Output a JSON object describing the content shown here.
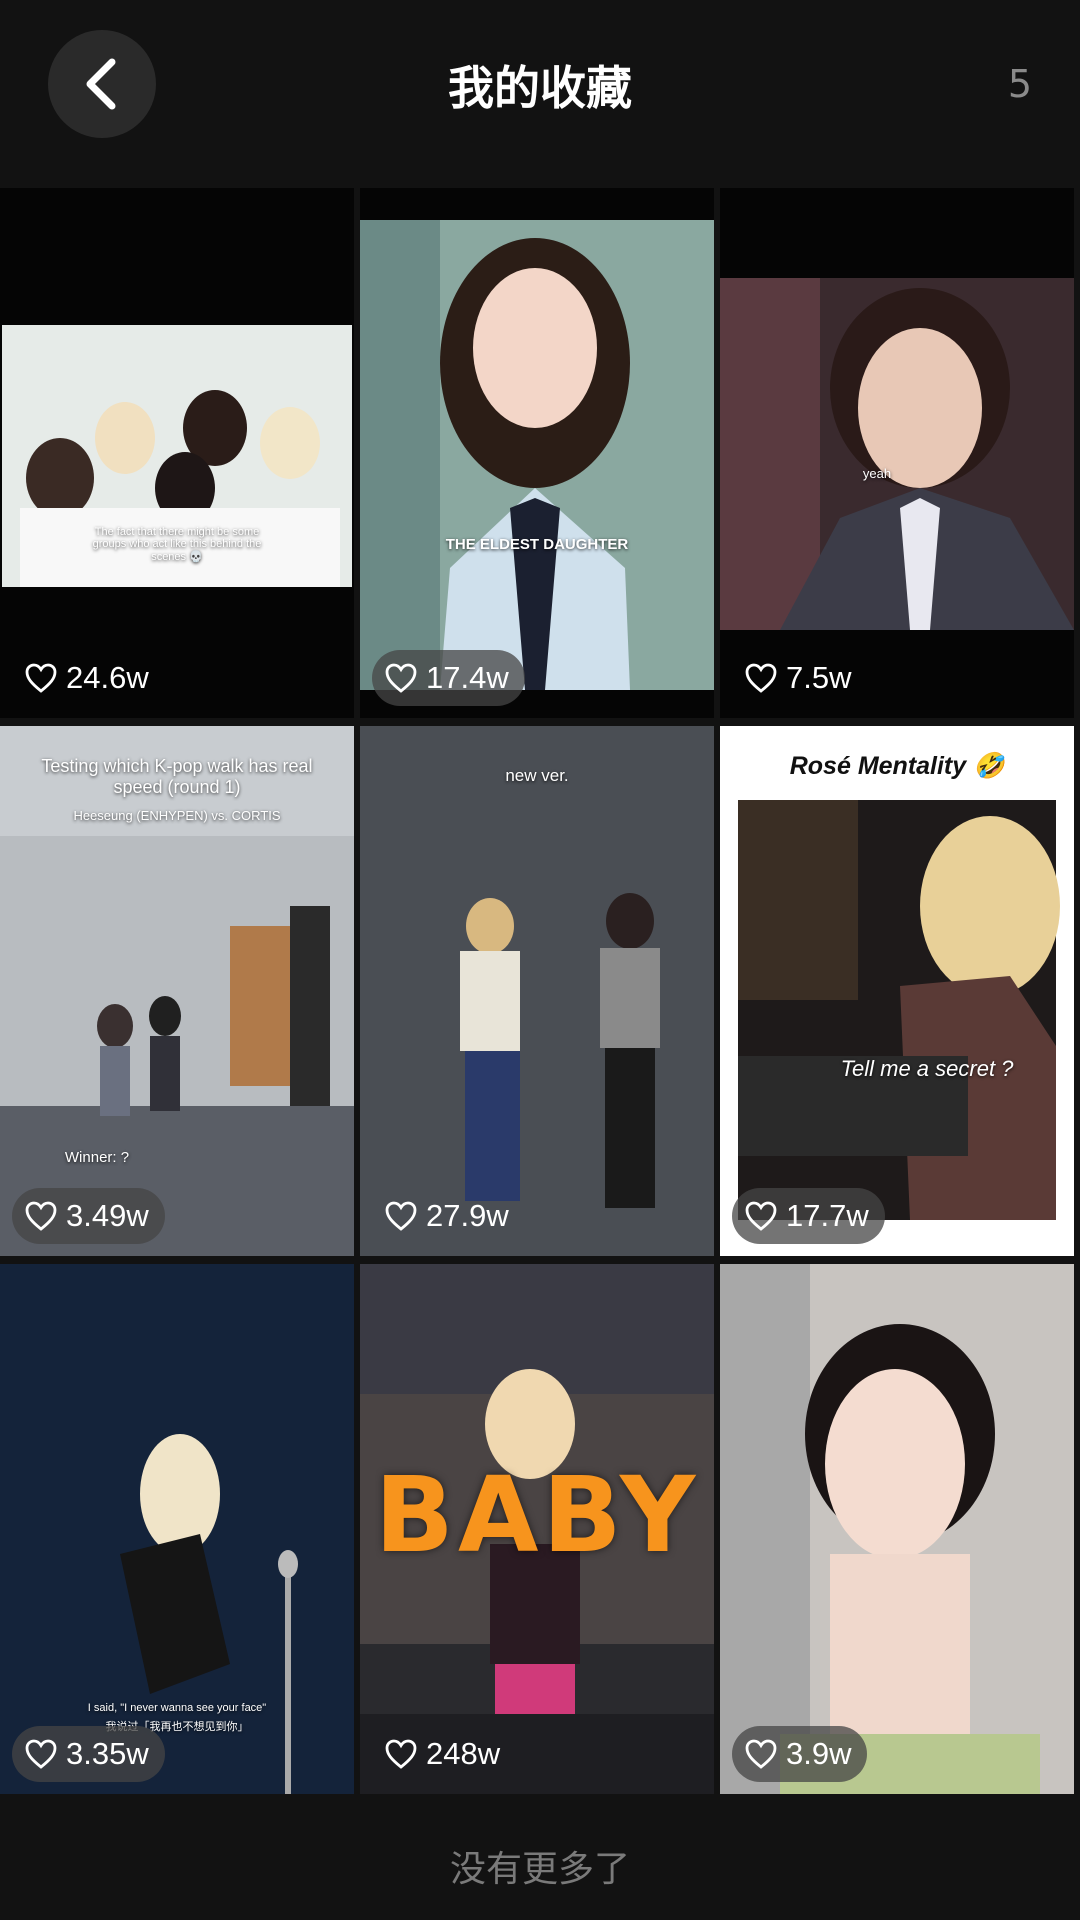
{
  "header": {
    "title": "我的收藏",
    "count": "5",
    "back_icon": "chevron-left-icon"
  },
  "videos": [
    {
      "likes": "24.6w",
      "caption": "The fact that there might be some groups who act like this behind the scenes 💀",
      "caption_top": "",
      "thumb": "five women in white tops group photo"
    },
    {
      "likes": "17.4w",
      "caption": "THE ELDEST DAUGHTER",
      "caption_top": "",
      "thumb": "girl in school uniform"
    },
    {
      "likes": "7.5w",
      "caption": "yeah",
      "caption_top": "",
      "thumb": "man in suit smiling"
    },
    {
      "likes": "3.49w",
      "caption": "Winner: ?",
      "caption_top": "Testing which K-pop walk has real speed (round 1)",
      "caption_sub": "Heeseung (ENHYPEN) vs. CORTIS",
      "thumb": "two people walking in hallway"
    },
    {
      "likes": "27.9w",
      "caption": "",
      "caption_top": "new ver.",
      "thumb": "two men dancing"
    },
    {
      "likes": "17.7w",
      "caption": "Tell me a secret ?",
      "caption_top": "Rosé Mentality 🤣",
      "thumb": "blonde woman at bar"
    },
    {
      "likes": "3.35w",
      "caption": "I said, \"I never wanna see your face\"",
      "caption_cn": "我说过「我再也不想见到你」",
      "caption_top": "",
      "thumb": "singer on stage"
    },
    {
      "likes": "248w",
      "caption": "",
      "caption_big": "BABY",
      "caption_top": "",
      "thumb": "performer in crowd"
    },
    {
      "likes": "3.9w",
      "caption": "",
      "caption_top": "",
      "thumb": "woman portrait"
    }
  ],
  "footer": {
    "text": "没有更多了"
  },
  "colors": {
    "background": "#121212",
    "text": "#ffffff",
    "muted": "#7a7a7a",
    "accent_baby": "#f7941d"
  },
  "icons": {
    "like": "heart-outline-icon"
  }
}
